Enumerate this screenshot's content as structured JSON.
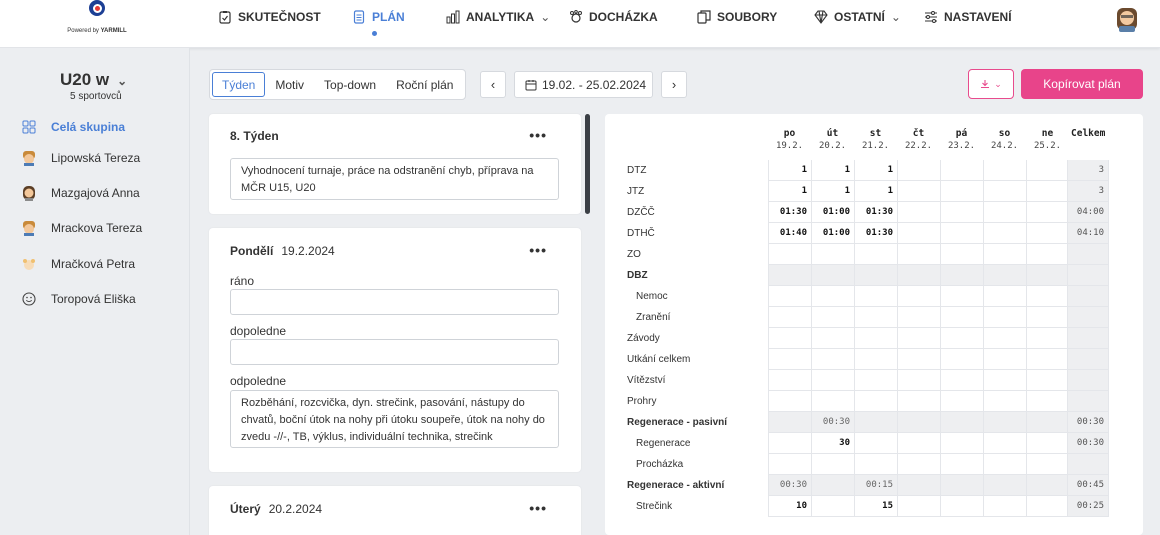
{
  "app": {
    "logo_caption_prefix": "Powered by",
    "logo_caption_brand": "YARMILL"
  },
  "nav": {
    "items": [
      {
        "label": "SKUTEČNOST",
        "icon": "clipboard-check-icon"
      },
      {
        "label": "PLÁN",
        "icon": "document-list-icon",
        "active": true
      },
      {
        "label": "ANALYTIKA",
        "icon": "bar-chart-icon",
        "dropdown": true
      },
      {
        "label": "DOCHÁZKA",
        "icon": "attendance-icon"
      },
      {
        "label": "SOUBORY",
        "icon": "files-icon"
      },
      {
        "label": "OSTATNÍ",
        "icon": "diamond-icon",
        "dropdown": true
      },
      {
        "label": "NASTAVENÍ",
        "icon": "sliders-icon"
      }
    ]
  },
  "sidebar": {
    "team_name": "U20 w",
    "team_count": "5 sportovců",
    "items": [
      {
        "label": "Celá skupina",
        "icon": "grid-icon",
        "active": true
      },
      {
        "label": "Lipowská Tereza",
        "icon": "athlete-avatar-icon"
      },
      {
        "label": "Mazgajová Anna",
        "icon": "athlete-avatar-icon"
      },
      {
        "label": "Mrackova Tereza",
        "icon": "athlete-avatar-icon"
      },
      {
        "label": "Mračková Petra",
        "icon": "athlete-avatar-icon"
      },
      {
        "label": "Toropová Eliška",
        "icon": "smiley-icon"
      }
    ]
  },
  "toolbar": {
    "view_tabs": [
      "Týden",
      "Motiv",
      "Top-down",
      "Roční plán"
    ],
    "active_view": "Týden",
    "date_range": "19.02. - 25.02.2024",
    "prev_label": "‹",
    "next_label": "›",
    "copy_label": "Kopírovat plán"
  },
  "week_card": {
    "title": "8. Týden",
    "note": "Vyhodnocení turnaje, práce na odstranění chyb, příprava na MČR U15, U20"
  },
  "monday_card": {
    "day": "Pondělí",
    "date": "19.2.2024",
    "morning_label": "ráno",
    "morning_value": "",
    "forenoon_label": "dopoledne",
    "forenoon_value": "",
    "afternoon_label": "odpoledne",
    "afternoon_value": "Rozběhání, rozcvička, dyn. strečink, pasování, nástupy do chvatů, boční útok na nohy při útoku soupeře, útok na nohy do zvedu -//-, TB, výklus, individuální technika, strečink"
  },
  "tuesday_card": {
    "day": "Úterý",
    "date": "20.2.2024"
  },
  "table": {
    "days": [
      {
        "d": "po",
        "date": "19.2."
      },
      {
        "d": "út",
        "date": "20.2."
      },
      {
        "d": "st",
        "date": "21.2."
      },
      {
        "d": "čt",
        "date": "22.2."
      },
      {
        "d": "pá",
        "date": "23.2."
      },
      {
        "d": "so",
        "date": "24.2."
      },
      {
        "d": "ne",
        "date": "25.2."
      }
    ],
    "total_header": "Celkem",
    "rows": [
      {
        "label": "DTZ",
        "values": [
          "1",
          "1",
          "1",
          "",
          "",
          "",
          ""
        ],
        "total": "3"
      },
      {
        "label": "JTZ",
        "values": [
          "1",
          "1",
          "1",
          "",
          "",
          "",
          ""
        ],
        "total": "3"
      },
      {
        "label": "DZČČ",
        "values": [
          "01:30",
          "01:00",
          "01:30",
          "",
          "",
          "",
          ""
        ],
        "total": "04:00"
      },
      {
        "label": "DTHČ",
        "values": [
          "01:40",
          "01:00",
          "01:30",
          "",
          "",
          "",
          ""
        ],
        "total": "04:10"
      },
      {
        "label": "ZO",
        "values": [
          "",
          "",
          "",
          "",
          "",
          "",
          ""
        ],
        "total": ""
      },
      {
        "label": "DBZ",
        "bold": true,
        "group": true,
        "values": [
          "",
          "",
          "",
          "",
          "",
          "",
          ""
        ],
        "total": ""
      },
      {
        "label": "Nemoc",
        "sub": true,
        "values": [
          "",
          "",
          "",
          "",
          "",
          "",
          ""
        ],
        "total": ""
      },
      {
        "label": "Zranění",
        "sub": true,
        "values": [
          "",
          "",
          "",
          "",
          "",
          "",
          ""
        ],
        "total": ""
      },
      {
        "label": "Závody",
        "values": [
          "",
          "",
          "",
          "",
          "",
          "",
          ""
        ],
        "total": ""
      },
      {
        "label": "Utkání celkem",
        "values": [
          "",
          "",
          "",
          "",
          "",
          "",
          ""
        ],
        "total": ""
      },
      {
        "label": "Vítězství",
        "values": [
          "",
          "",
          "",
          "",
          "",
          "",
          ""
        ],
        "total": ""
      },
      {
        "label": "Prohry",
        "values": [
          "",
          "",
          "",
          "",
          "",
          "",
          ""
        ],
        "total": ""
      },
      {
        "label": "Regenerace - pasivní",
        "bold": true,
        "group": true,
        "values": [
          "",
          "00:30",
          "",
          "",
          "",
          "",
          ""
        ],
        "total": "00:30"
      },
      {
        "label": "Regenerace",
        "sub": true,
        "values": [
          "",
          "30",
          "",
          "",
          "",
          "",
          ""
        ],
        "total": "00:30"
      },
      {
        "label": "Procházka",
        "sub": true,
        "values": [
          "",
          "",
          "",
          "",
          "",
          "",
          ""
        ],
        "total": ""
      },
      {
        "label": "Regenerace - aktivní",
        "bold": true,
        "group": true,
        "values": [
          "00:30",
          "",
          "00:15",
          "",
          "",
          "",
          ""
        ],
        "total": "00:45"
      },
      {
        "label": "Strečink",
        "sub": true,
        "values": [
          "10",
          "",
          "15",
          "",
          "",
          "",
          ""
        ],
        "total": "00:25"
      }
    ]
  },
  "colors": {
    "accent": "#4a7fd6",
    "primary_button": "#e8448a",
    "background": "#eceef1"
  }
}
